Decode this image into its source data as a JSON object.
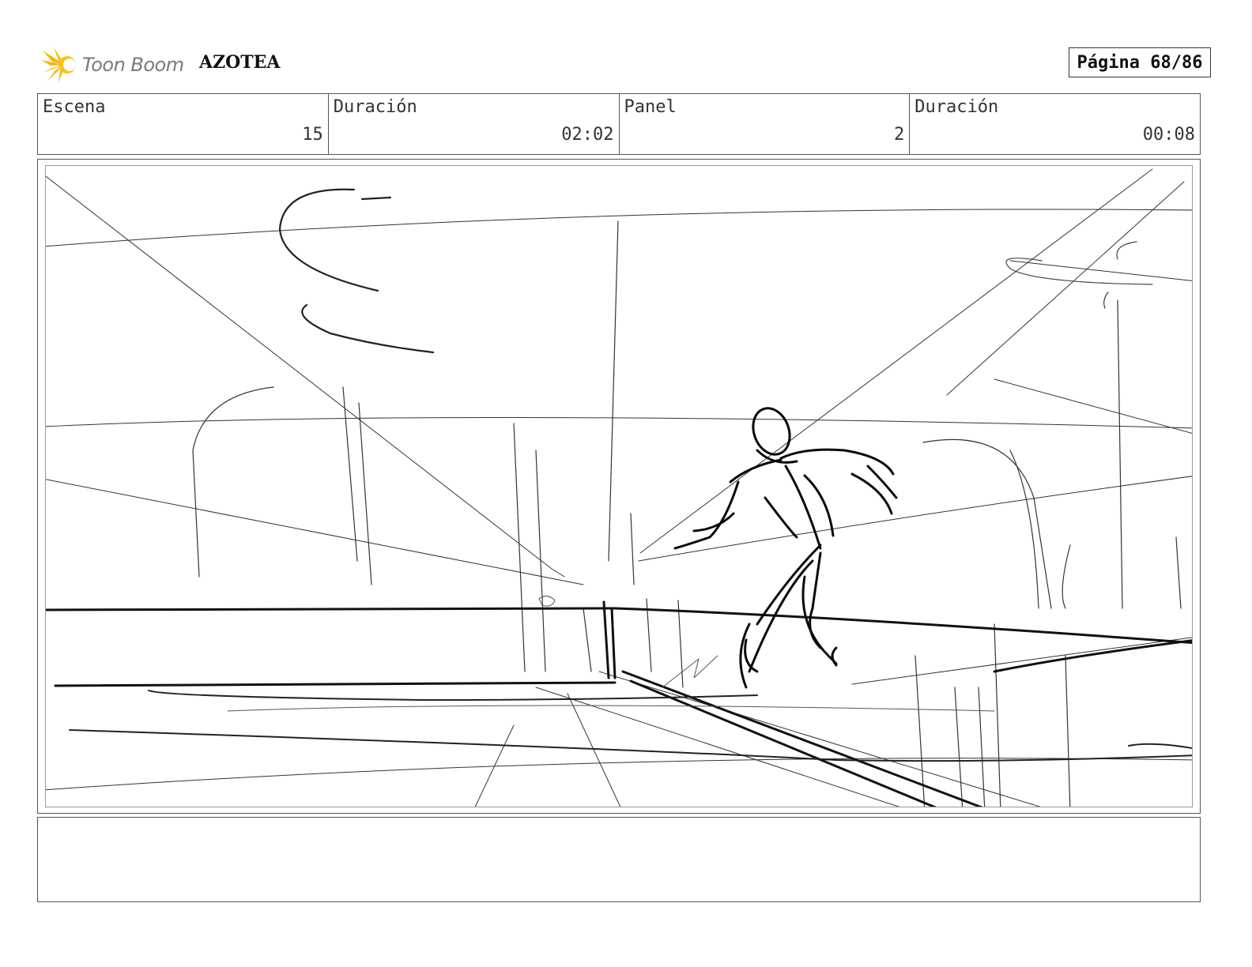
{
  "header": {
    "logo_text": "Toon Boom",
    "project_title": "AZOTEA",
    "page_label": "Página 68/86"
  },
  "info": [
    {
      "label": "Escena",
      "value": "15"
    },
    {
      "label": "Duración",
      "value": "02:02"
    },
    {
      "label": "Panel",
      "value": "2"
    },
    {
      "label": "Duración",
      "value": "00:08"
    }
  ],
  "panel": {
    "image_name": "rooftop-sketch-figure-running"
  },
  "notes": {
    "text": ""
  },
  "colors": {
    "logo_sun": "#f5b800",
    "frame": "#555555",
    "sketch": "#111111"
  }
}
